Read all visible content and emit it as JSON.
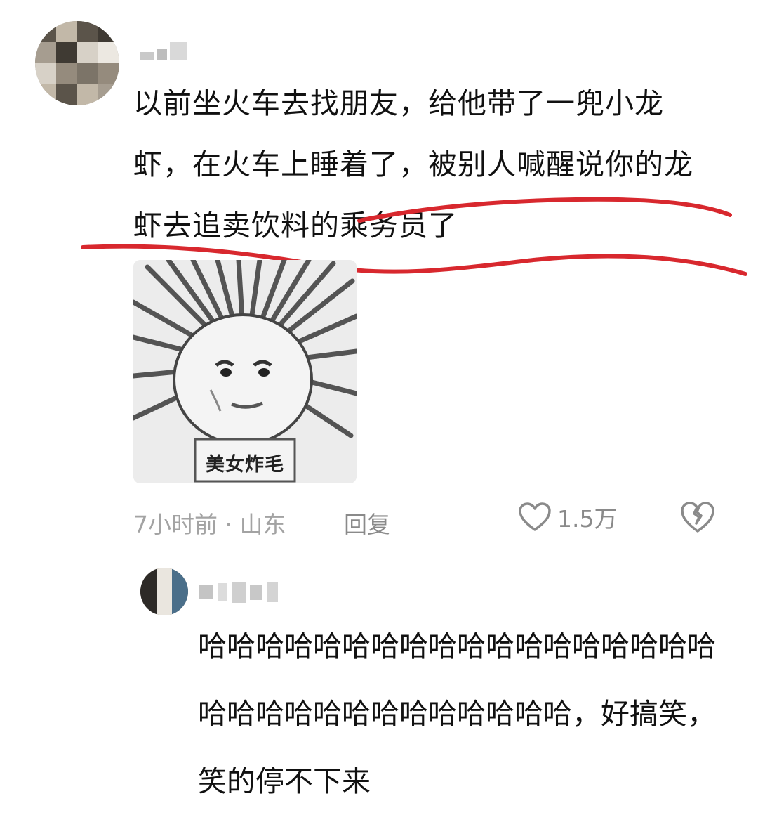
{
  "comment": {
    "text": "以前坐火车去找朋友，给他带了一兜小龙虾，在火车上睡着了，被别人喊醒说你的龙虾去追卖饮料的乘务员了",
    "meme_caption": "美女炸毛",
    "time_location": "7小时前 · 山东",
    "reply_label": "回复",
    "like_count": "1.5万",
    "annotation_color": "#d8282e"
  },
  "reply": {
    "text": "哈哈哈哈哈哈哈哈哈哈哈哈哈哈哈哈哈哈哈哈哈哈哈哈哈哈哈哈哈哈哈，好搞笑，笑的停不下来"
  },
  "icons": [
    "heart-outline-icon",
    "broken-heart-icon"
  ]
}
